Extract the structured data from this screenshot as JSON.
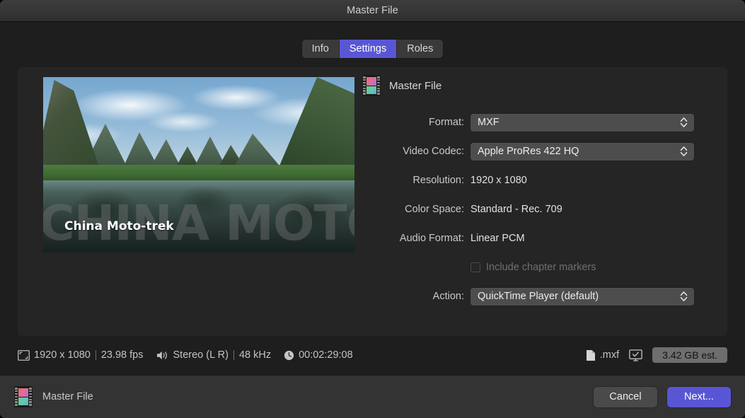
{
  "window": {
    "title": "Master File"
  },
  "tabs": [
    {
      "label": "Info",
      "active": false
    },
    {
      "label": "Settings",
      "active": true
    },
    {
      "label": "Roles",
      "active": false
    }
  ],
  "preview": {
    "overlay_watermark": "CHINA MOTO-TREK",
    "overlay_title": "China Moto-trek"
  },
  "form": {
    "heading": "Master File",
    "icon": "film-strip-icon",
    "fields": [
      {
        "label": "Format:",
        "value": "MXF",
        "type": "popup"
      },
      {
        "label": "Video Codec:",
        "value": "Apple ProRes 422 HQ",
        "type": "popup"
      },
      {
        "label": "Resolution:",
        "value": "1920 x 1080",
        "type": "text"
      },
      {
        "label": "Color Space:",
        "value": "Standard - Rec. 709",
        "type": "text"
      },
      {
        "label": "Audio Format:",
        "value": "Linear PCM",
        "type": "text"
      }
    ],
    "checkbox": {
      "label": "Include chapter markers",
      "checked": false,
      "enabled": false
    },
    "action": {
      "label": "Action:",
      "value": "QuickTime Player (default)",
      "type": "popup"
    }
  },
  "status": {
    "resolution": "1920 x 1080",
    "frame_rate": "23.98 fps",
    "audio_channels": "Stereo (L R)",
    "sample_rate": "48 kHz",
    "duration": "00:02:29:08",
    "extension": ".mxf",
    "destination_icon": "display-check-icon",
    "estimated_size": "3.42 GB est."
  },
  "footer": {
    "name": "Master File",
    "icon": "film-strip-icon",
    "cancel_label": "Cancel",
    "next_label": "Next..."
  },
  "colors": {
    "accent": "#5956d6",
    "window_bg": "#1e1e1e",
    "panel_bg": "#252525",
    "bottom_bar_bg": "#333333",
    "popup_bg": "#4d4d4d",
    "pill_bg": "#6e6e6e"
  }
}
